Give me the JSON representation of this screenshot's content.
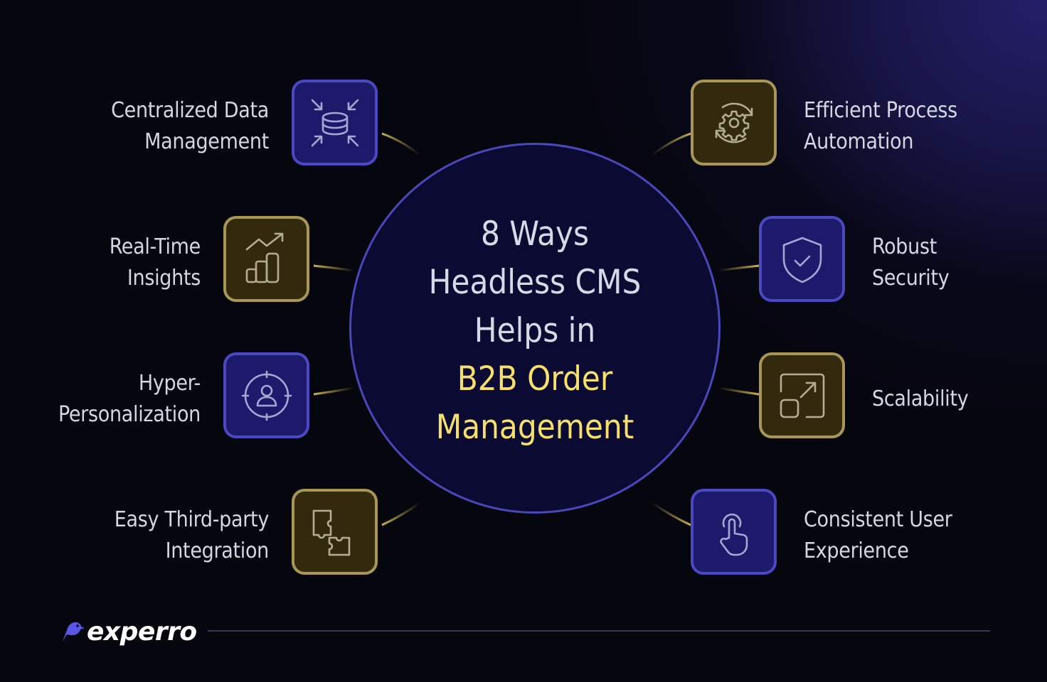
{
  "title": {
    "line1": "8 Ways",
    "line2": "Headless CMS",
    "line3": "Helps in",
    "highlight1": "B2B Order",
    "highlight2": "Management"
  },
  "colors": {
    "background": "#06060f",
    "circle_fill": "#0b0a33",
    "circle_border": "#4a47b8",
    "blue_tile_fill": "#1d1a6b",
    "blue_tile_border": "#4b48c2",
    "gold_tile_fill": "#332a0e",
    "gold_tile_border": "#a79656",
    "highlight_text": "#f6df6a",
    "label_text": "#d5d6e3"
  },
  "features": [
    {
      "lines": [
        "Centralized Data",
        "Management"
      ],
      "icon": "database-converge-icon",
      "style": "blue",
      "side": "left"
    },
    {
      "lines": [
        "Real-Time",
        "Insights"
      ],
      "icon": "growth-chart-icon",
      "style": "gold",
      "side": "left"
    },
    {
      "lines": [
        "Hyper-",
        "Personalization"
      ],
      "icon": "user-target-icon",
      "style": "blue",
      "side": "left"
    },
    {
      "lines": [
        "Easy Third-party",
        "Integration"
      ],
      "icon": "puzzle-pieces-icon",
      "style": "gold",
      "side": "left"
    },
    {
      "lines": [
        "Efficient Process",
        "Automation"
      ],
      "icon": "gear-cycle-icon",
      "style": "gold",
      "side": "right"
    },
    {
      "lines": [
        "Robust",
        "Security"
      ],
      "icon": "shield-check-icon",
      "style": "blue",
      "side": "right"
    },
    {
      "lines": [
        "Scalability"
      ],
      "icon": "scale-up-icon",
      "style": "gold",
      "side": "right"
    },
    {
      "lines": [
        "Consistent User",
        "Experience"
      ],
      "icon": "touch-hand-icon",
      "style": "blue",
      "side": "right"
    }
  ],
  "brand": {
    "name": "experro",
    "icon": "bird-logo-icon"
  }
}
